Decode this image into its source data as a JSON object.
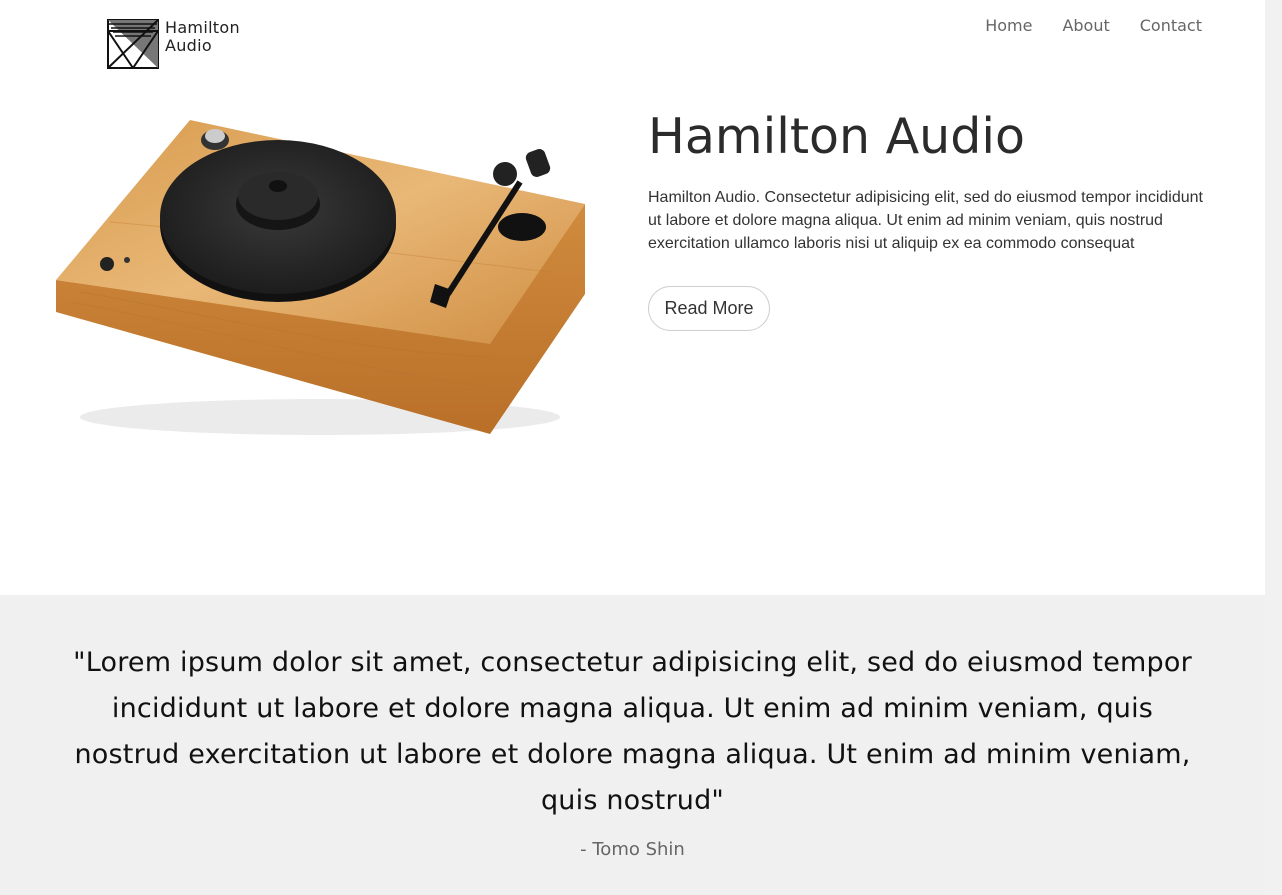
{
  "header": {
    "logo_line1": "Hamilton",
    "logo_line2": "Audio",
    "nav": [
      {
        "label": "Home"
      },
      {
        "label": "About"
      },
      {
        "label": "Contact"
      }
    ]
  },
  "hero": {
    "title": "Hamilton Audio",
    "description": "Hamilton Audio. Consectetur adipisicing elit, sed do eiusmod tempor incididunt ut labore et dolore magna aliqua. Ut enim ad minim veniam, quis nostrud exercitation ullamco laboris nisi ut aliquip ex ea commodo consequat",
    "button_label": "Read More"
  },
  "testimonial": {
    "quote": "\"Lorem ipsum dolor sit amet, consectetur adipisicing elit, sed do eiusmod tempor incididunt ut labore et dolore magna aliqua. Ut enim ad minim veniam, quis nostrud exercitation ut labore et dolore magna aliqua. Ut enim ad minim veniam, quis nostrud\"",
    "author": "- Tomo Shin"
  },
  "colors": {
    "testimonial_bg": "#f0f0f0",
    "wood": "#d9a35a",
    "platter": "#222222"
  },
  "icons": {
    "logo": "hamilton-audio-logo",
    "product_image": "turntable"
  }
}
